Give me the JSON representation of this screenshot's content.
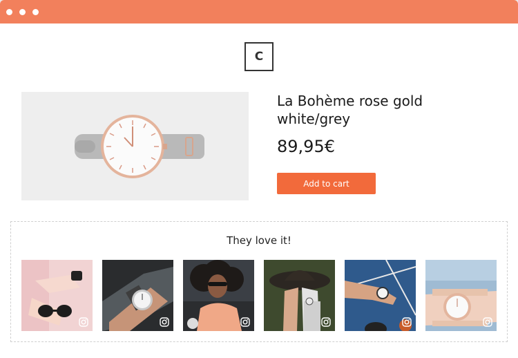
{
  "window": {
    "accent": "#f2805c"
  },
  "brand": {
    "logo_letter": "C"
  },
  "product": {
    "title": "La Bohème rose gold white/grey",
    "price": "89,95€",
    "add_to_cart_label": "Add to cart",
    "button_color": "#f26a3b"
  },
  "gallery": {
    "heading": "They love it!",
    "photos": [
      {
        "icon": "instagram-icon"
      },
      {
        "icon": "instagram-icon"
      },
      {
        "icon": "instagram-icon"
      },
      {
        "icon": "instagram-icon"
      },
      {
        "icon": "instagram-icon"
      },
      {
        "icon": "instagram-icon"
      }
    ]
  }
}
